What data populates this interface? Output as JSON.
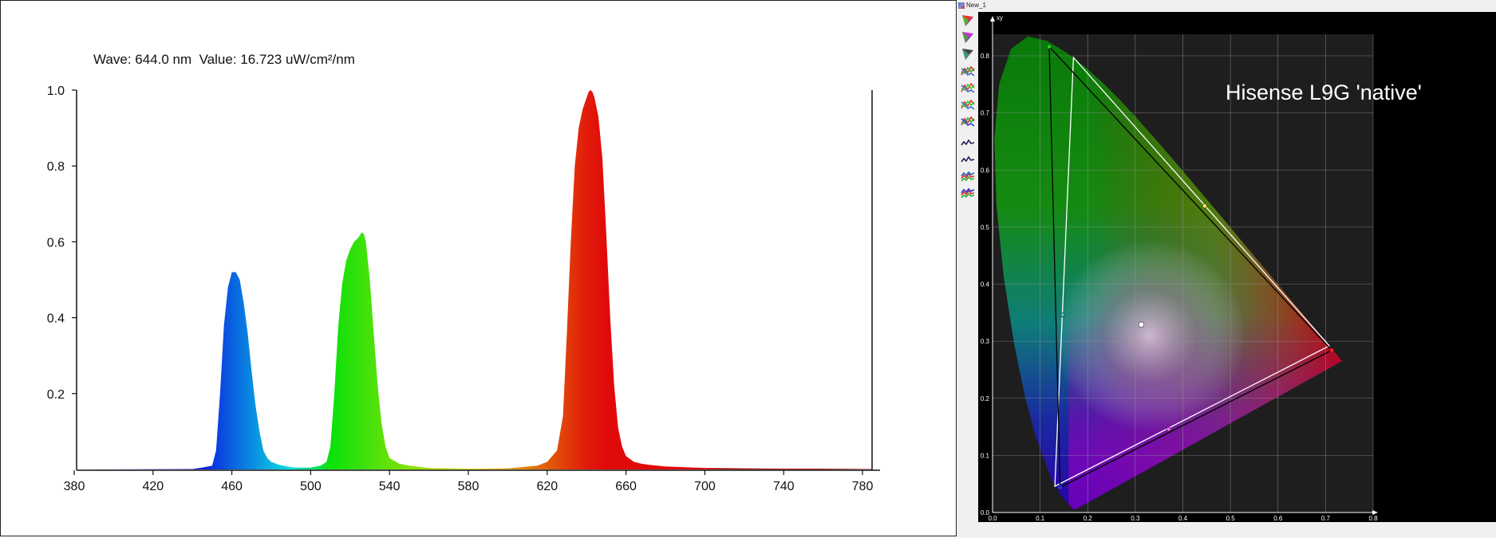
{
  "spectrum": {
    "readout": "Wave: 644.0 nm  Value: 16.723 uW/cm²/nm",
    "x_ticks": [
      "380",
      "420",
      "460",
      "500",
      "540",
      "580",
      "620",
      "660",
      "700",
      "740",
      "780"
    ],
    "y_ticks": [
      "0.2",
      "0.4",
      "0.6",
      "0.8",
      "1.0"
    ]
  },
  "cie": {
    "window_title": "New_1",
    "axis_label": "xy",
    "title": "Hisense L9G 'native'",
    "x_ticks": [
      "0.0",
      "0.1",
      "0.2",
      "0.3",
      "0.4",
      "0.5",
      "0.6",
      "0.7",
      "0.8"
    ],
    "y_ticks": [
      "0.0",
      "0.1",
      "0.2",
      "0.3",
      "0.4",
      "0.5",
      "0.6",
      "0.7",
      "0.8"
    ],
    "toolbar": [
      {
        "name": "cie-1931-icon",
        "colors": [
          "#e33",
          "#3c3",
          "#33e"
        ]
      },
      {
        "name": "cie-1976-icon",
        "colors": [
          "#c3c",
          "#3a3",
          "#33c"
        ]
      },
      {
        "name": "color-solid-icon",
        "colors": [
          "#444",
          "#3a8",
          "#c84"
        ]
      },
      {
        "name": "cmf-curves-icon",
        "colors": [
          "#c33",
          "#3a3",
          "#36c"
        ]
      },
      {
        "name": "rgb-curves-icon",
        "colors": [
          "#e33",
          "#3c3",
          "#36c"
        ]
      },
      {
        "name": "gamma-curves-icon",
        "colors": [
          "#e33",
          "#3c3",
          "#36c"
        ]
      },
      {
        "name": "multi-curves-icon",
        "colors": [
          "#c33",
          "#3a3",
          "#33c"
        ]
      },
      {
        "name": "spectrum-line-icon",
        "colors": [
          "#225",
          "#225",
          "#225"
        ]
      },
      {
        "name": "spectrum-step-icon",
        "colors": [
          "#225",
          "#225",
          "#225"
        ]
      },
      {
        "name": "spectrum-rgb-icon",
        "colors": [
          "#c33",
          "#3a3",
          "#36c"
        ]
      },
      {
        "name": "spectrum-fill-icon",
        "colors": [
          "#c33",
          "#3a3",
          "#33c"
        ]
      }
    ]
  },
  "chart_data": [
    {
      "type": "area",
      "title": "",
      "xlabel": "",
      "ylabel": "",
      "xlim": [
        380,
        785
      ],
      "ylim": [
        0,
        1.0
      ],
      "grid": false,
      "x": [
        380,
        440,
        445,
        450,
        452,
        454,
        456,
        458,
        460,
        462,
        464,
        466,
        468,
        470,
        472,
        474,
        476,
        478,
        480,
        484,
        488,
        492,
        500,
        505,
        508,
        510,
        512,
        514,
        516,
        518,
        520,
        522,
        524,
        526,
        527,
        528,
        530,
        532,
        534,
        536,
        538,
        540,
        545,
        550,
        560,
        580,
        600,
        615,
        620,
        625,
        628,
        630,
        632,
        634,
        636,
        638,
        640,
        641,
        642,
        643,
        644,
        646,
        648,
        650,
        652,
        654,
        656,
        658,
        660,
        664,
        668,
        672,
        680,
        700,
        720,
        740,
        760,
        785
      ],
      "values": [
        0,
        0.001,
        0.005,
        0.01,
        0.05,
        0.2,
        0.38,
        0.48,
        0.52,
        0.52,
        0.5,
        0.44,
        0.36,
        0.26,
        0.17,
        0.1,
        0.05,
        0.03,
        0.02,
        0.012,
        0.008,
        0.005,
        0.005,
        0.01,
        0.02,
        0.06,
        0.2,
        0.38,
        0.49,
        0.55,
        0.58,
        0.6,
        0.61,
        0.625,
        0.62,
        0.6,
        0.5,
        0.36,
        0.22,
        0.12,
        0.06,
        0.03,
        0.015,
        0.01,
        0.004,
        0.002,
        0.003,
        0.01,
        0.02,
        0.05,
        0.14,
        0.36,
        0.6,
        0.8,
        0.9,
        0.95,
        0.98,
        0.995,
        1.0,
        0.995,
        0.98,
        0.93,
        0.82,
        0.62,
        0.4,
        0.22,
        0.11,
        0.06,
        0.035,
        0.02,
        0.015,
        0.012,
        0.008,
        0.004,
        0.003,
        0.002,
        0.002,
        0.001
      ]
    },
    {
      "type": "scatter",
      "title": "Hisense L9G 'native'",
      "xlabel": "",
      "ylabel": "xy",
      "xlim": [
        0.0,
        0.8
      ],
      "ylim": [
        0.0,
        0.85
      ],
      "grid": true,
      "spectral_locus": {
        "x": [
          0.1741,
          0.1738,
          0.1736,
          0.1733,
          0.1726,
          0.1714,
          0.1689,
          0.1644,
          0.1566,
          0.144,
          0.1241,
          0.0913,
          0.0687,
          0.0454,
          0.0235,
          0.0082,
          0.0039,
          0.0139,
          0.0389,
          0.0743,
          0.1142,
          0.1547,
          0.1929,
          0.2296,
          0.2658,
          0.3016,
          0.3373,
          0.3731,
          0.4087,
          0.4441,
          0.4788,
          0.5125,
          0.5448,
          0.5752,
          0.6029,
          0.627,
          0.6482,
          0.6658,
          0.6801,
          0.6915,
          0.7006,
          0.7079,
          0.714,
          0.719,
          0.723,
          0.726,
          0.7283,
          0.73,
          0.7311,
          0.732,
          0.7327,
          0.7334,
          0.734,
          0.7344,
          0.7346,
          0.7347
        ],
        "y": [
          0.005,
          0.0049,
          0.005,
          0.0048,
          0.0048,
          0.0051,
          0.0069,
          0.0109,
          0.0177,
          0.0297,
          0.0578,
          0.1327,
          0.2007,
          0.295,
          0.4127,
          0.5384,
          0.6548,
          0.7502,
          0.812,
          0.8338,
          0.8262,
          0.8059,
          0.7816,
          0.7543,
          0.7243,
          0.6923,
          0.6589,
          0.6245,
          0.5896,
          0.5547,
          0.5202,
          0.4866,
          0.4544,
          0.4242,
          0.3965,
          0.3725,
          0.3514,
          0.334,
          0.3197,
          0.3083,
          0.2993,
          0.292,
          0.2859,
          0.2809,
          0.277,
          0.274,
          0.2717,
          0.27,
          0.2689,
          0.268,
          0.2673,
          0.2666,
          0.266,
          0.2656,
          0.2654,
          0.2653
        ]
      },
      "series": [
        {
          "name": "",
          "x": [
            0.708,
            0.17,
            0.131,
            0.708
          ],
          "y": [
            0.292,
            0.797,
            0.046,
            0.292
          ]
        },
        {
          "name": "",
          "x": [
            0.713,
            0.119,
            0.142,
            0.713
          ],
          "y": [
            0.284,
            0.816,
            0.044,
            0.284
          ]
        }
      ],
      "points": [
        {
          "x": 0.3127,
          "y": 0.329,
          "color": "#ffffff"
        },
        {
          "x": 0.446,
          "y": 0.537,
          "color": "#ffff33"
        },
        {
          "x": 0.147,
          "y": 0.346,
          "color": "#33cccc"
        },
        {
          "x": 0.37,
          "y": 0.146,
          "color": "#ff66ff"
        },
        {
          "x": 0.119,
          "y": 0.816,
          "color": "#22dd22"
        },
        {
          "x": 0.713,
          "y": 0.284,
          "color": "#ff2222"
        },
        {
          "x": 0.142,
          "y": 0.044,
          "color": "#2233ff"
        }
      ]
    }
  ]
}
